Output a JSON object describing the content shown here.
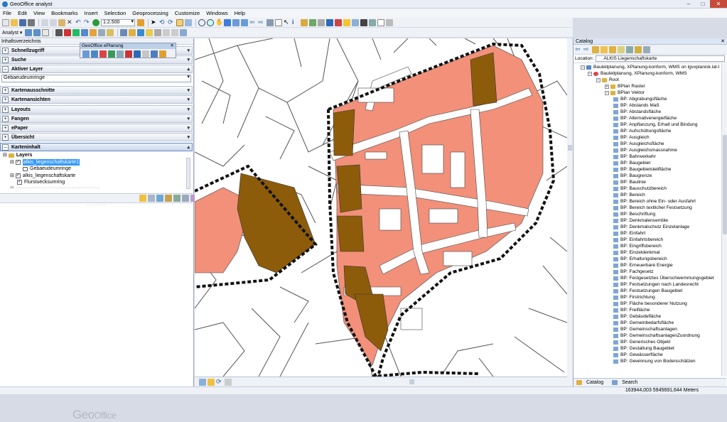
{
  "app": {
    "title": "GeoOffice analyst"
  },
  "window_buttons": [
    "–",
    "□",
    "✕"
  ],
  "menu": [
    "File",
    "Edit",
    "View",
    "Bookmarks",
    "Insert",
    "Selection",
    "Geoprocessing",
    "Customize",
    "Windows",
    "Help"
  ],
  "toolbar": {
    "scale": "1:2.500",
    "analyst_label": "Analyst ▾"
  },
  "left_panel": {
    "title": "Inhaltsverzeichnis",
    "sections": {
      "schnellzugriff": "Schnellzugriff",
      "suche": "Suche",
      "aktiver_layer": "Aktiver Layer",
      "kartenausschnitte": "Kartenausschnitte",
      "kartenansichten": "Kartenansichten",
      "layouts": "Layouts",
      "fangen": "Fangen",
      "epaper": "ePaper",
      "uebersicht": "Übersicht",
      "karteninhalt": "Karteninhalt"
    },
    "active_layer_value": "Gebaeudeumringe",
    "tree": {
      "layers": "Layers",
      "item1": "alkis_liegenschaftskarte1",
      "item1_child": "Gebaeudeumringe",
      "item2": "alkis_liegenschaftskarte",
      "item2_child": "Flurstuecksumring"
    },
    "logo": {
      "geo": "Geo",
      "office": "Office"
    }
  },
  "eplanung": {
    "title": "GeoOffice ePlanung"
  },
  "catalog": {
    "title": "Catalog",
    "location_label": "Location:",
    "location_value": "ALKIS Liegenschaftskarte",
    "tree_top": [
      "Bauleitplanung, XPlanung-konform, WMS on lgvxplanisk.lat-l",
      "Bauleitplanung, XPlanung-konform, WMS",
      "Root",
      "BPlan Raster",
      "BPlan Vektor"
    ],
    "bp_items": [
      "BP: Abgrabungsfläche",
      "BP: Abstands Maß",
      "BP: Abstandsfläche",
      "BP: Alternativenergiefläche",
      "BP: Anpflanzung, Erhalt und Bindung",
      "BP: Aufschüttungsfläche",
      "BP: Ausgleich",
      "BP: Ausgleichsfläche",
      "BP: Ausgleichsmassnahme",
      "BP: Bahnverkehr",
      "BP: Baugebiet",
      "BP: Baugebietsteilfläche",
      "BP: Baugrenze",
      "BP: Baulinie",
      "BP: Bauschutzbereich",
      "BP: Bereich",
      "BP: Bereich ohne Ein- oder Ausfahrt",
      "BP: Bereich textlicher Festsetzung",
      "BP: Beschriftung",
      "BP: Denkmalensemble",
      "BP: Denkmalschutz Einzelanlage",
      "BP: Einfahrt",
      "BP: Einfahrtsbereich",
      "BP: Eingriffsbereich",
      "BP: Einzeldenkmal",
      "BP: Erhaltungsbereich",
      "BP: Erneuerbare Energie",
      "BP: Fachgesetz",
      "BP: Festgesetztes Überschwemmungsgebiet",
      "BP: Festsetzungen nach Landesrecht",
      "BP: Festsetzungen Baugebiet",
      "BP: Firstrichtung",
      "BP: Fläche besonderer Nutzung",
      "BP: Freifläche",
      "BP: Gebäudefläche",
      "BP: Gemeinbedarfsfläche",
      "BP: Gemeinschaftsanlagen",
      "BP: GemeinschaftsanlagenZuordnung",
      "BP: Generisches Objekt",
      "BP: Gestaltung Baugebiet",
      "BP: Gewässerfläche",
      "BP: Gewinnung von Bodenschätzen"
    ],
    "tabs": {
      "catalog": "Catalog",
      "search": "Search"
    }
  },
  "status": {
    "coords": "163944,003  5945691,644 Meters"
  },
  "colors": {
    "salmon": "#f2907a",
    "brown": "#8c5c0a",
    "boundary": "#111111",
    "accent": "#3399ff"
  }
}
